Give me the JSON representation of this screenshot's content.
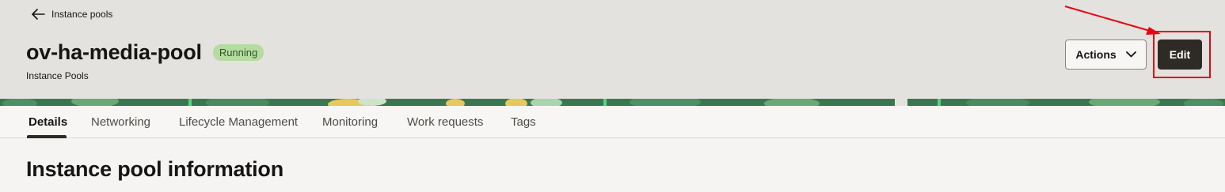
{
  "breadcrumb": {
    "back_label": "Instance pools"
  },
  "header": {
    "title": "ov-ha-media-pool",
    "status": "Running",
    "subtitle": "Instance Pools",
    "actions_label": "Actions",
    "edit_label": "Edit"
  },
  "tabs": [
    {
      "label": "Details",
      "active": true
    },
    {
      "label": "Networking",
      "active": false
    },
    {
      "label": "Lifecycle Management",
      "active": false
    },
    {
      "label": "Monitoring",
      "active": false
    },
    {
      "label": "Work requests",
      "active": false
    },
    {
      "label": "Tags",
      "active": false
    }
  ],
  "section": {
    "title": "Instance pool information"
  },
  "icons": {
    "back": "arrow-left-icon",
    "dropdown": "chevron-down-icon"
  },
  "colors": {
    "status_badge_bg": "#b6dba2",
    "primary_button": "#2e2a26",
    "annotation": "#e30613"
  }
}
